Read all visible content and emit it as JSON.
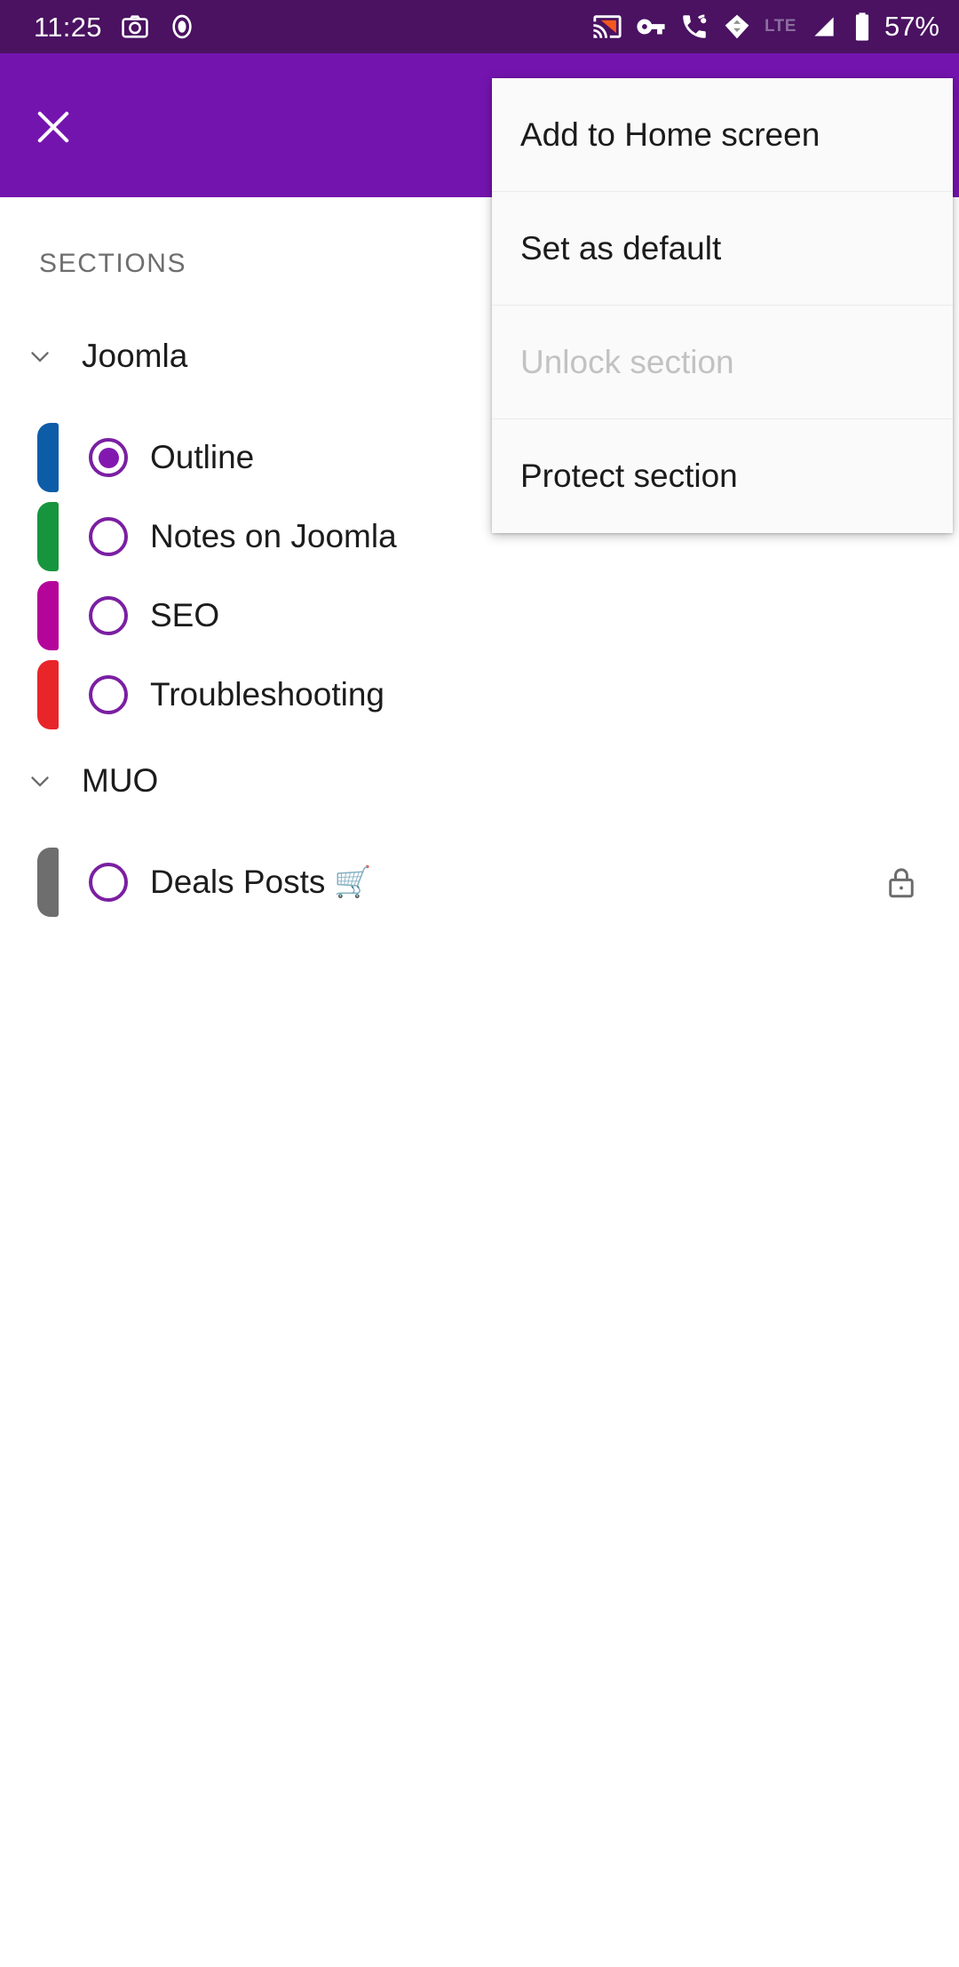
{
  "status_bar": {
    "clock": "11:25",
    "battery_text": "57%",
    "network_label": "LTE",
    "icons": [
      "camera-icon",
      "record-circle-icon",
      "cast-screen-icon",
      "vpn-key-icon",
      "call-wifi-icon",
      "location-diamond-icon",
      "signal-bars-icon",
      "battery-icon"
    ],
    "background_color": "#4A1261"
  },
  "app_bar": {
    "close_label": "close-icon",
    "background_color": "#7414AF"
  },
  "drawer": {
    "header_label": "SECTIONS",
    "groups": [
      {
        "name": "Joomla",
        "expanded": true,
        "chevron": "chevron-down-icon",
        "items": [
          {
            "label": "Outline",
            "color": "#0D5CA8",
            "selected": true,
            "locked": false
          },
          {
            "label": "Notes on Joomla",
            "color": "#17953E",
            "selected": false,
            "locked": false
          },
          {
            "label": "SEO",
            "color": "#B5049A",
            "selected": false,
            "locked": false
          },
          {
            "label": "Troubleshooting",
            "color": "#E8262A",
            "selected": false,
            "locked": false
          }
        ]
      },
      {
        "name": "MUO",
        "expanded": true,
        "chevron": "chevron-down-icon",
        "items": [
          {
            "label": "Deals Posts",
            "emoji": "🛒",
            "color": "#6E6E6E",
            "selected": false,
            "locked": true
          }
        ]
      }
    ],
    "accent_color": "#7B1FA2"
  },
  "popup_menu": {
    "items": [
      {
        "label": "Add to Home screen",
        "disabled": false
      },
      {
        "label": "Set as default",
        "disabled": false
      },
      {
        "label": "Unlock section",
        "disabled": true
      },
      {
        "label": "Protect section",
        "disabled": false
      }
    ],
    "background_color": "#FAFAFA"
  }
}
